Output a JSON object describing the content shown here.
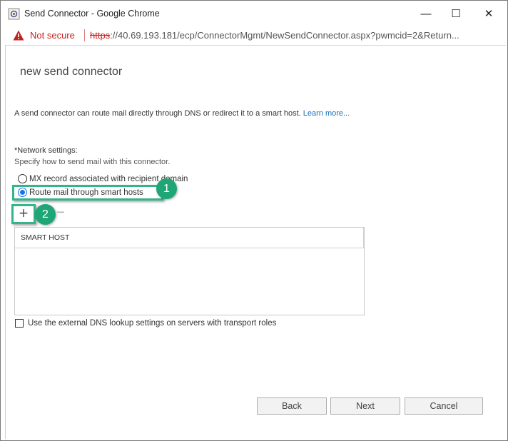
{
  "window": {
    "title": "Send Connector - Google Chrome",
    "controls": {
      "minimize": "—",
      "maximize": "☐",
      "close": "✕"
    }
  },
  "address_bar": {
    "security_text": "Not secure",
    "url_scheme": "https",
    "url_rest": "://40.69.193.181/ecp/ConnectorMgmt/NewSendConnector.aspx?pwmcid=2&Return..."
  },
  "page": {
    "title": "new send connector",
    "intro": "A send connector can route mail directly through DNS or redirect it to a smart host.",
    "learn_more": "Learn more...",
    "network_label": "*Network settings:",
    "network_desc": "Specify how to send mail with this connector.",
    "options": [
      {
        "label": "MX record associated with recipient domain",
        "checked": false
      },
      {
        "label": "Route mail through smart hosts",
        "checked": true
      }
    ],
    "toolbar": {
      "add": "+",
      "remove": "−"
    },
    "table": {
      "header": "SMART HOST",
      "rows": []
    },
    "dns_checkbox": {
      "label": "Use the external DNS lookup settings on servers with transport roles",
      "checked": false
    },
    "buttons": {
      "back": "Back",
      "next": "Next",
      "cancel": "Cancel"
    }
  },
  "annotations": {
    "badge1": "1",
    "badge2": "2",
    "highlight_color": "#33b58c",
    "badge_color": "#1ea677"
  }
}
